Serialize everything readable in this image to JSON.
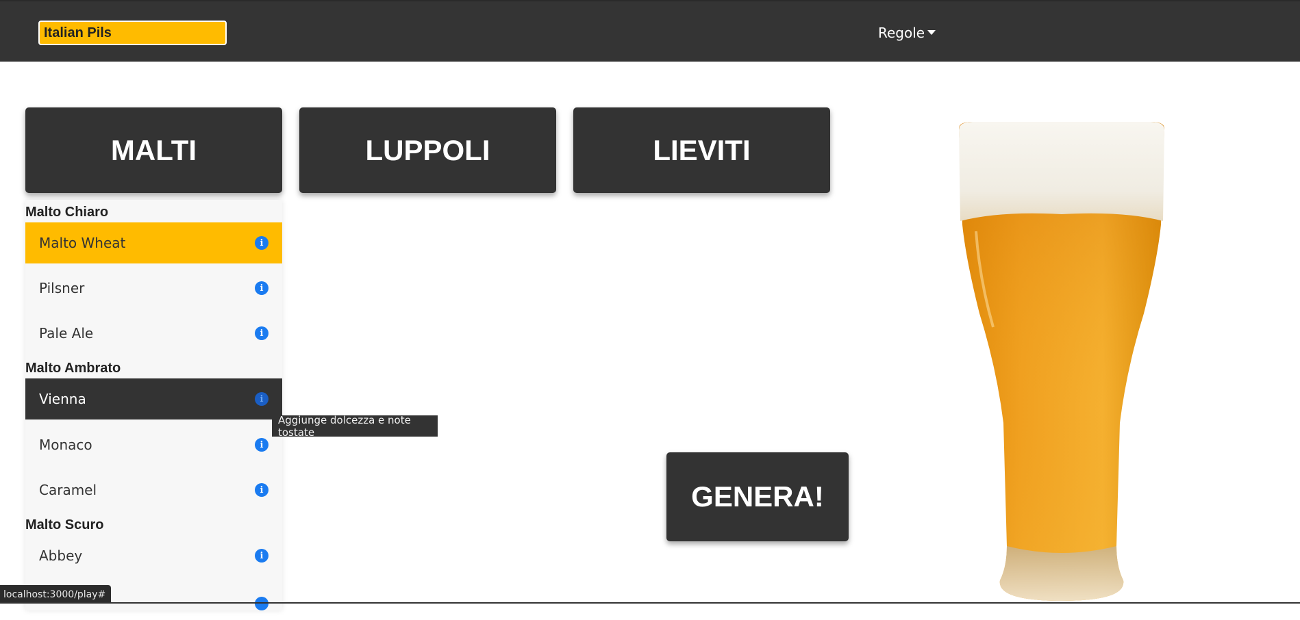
{
  "header": {
    "beer_name_value": "Italian Pils",
    "rules_label": "Regole"
  },
  "categories": {
    "malti": "MALTI",
    "luppoli": "LUPPOLI",
    "lieviti": "LIEVITI"
  },
  "malts": {
    "group1": {
      "title": "Malto Chiaro",
      "items": [
        "Malto Wheat",
        "Pilsner",
        "Pale Ale"
      ]
    },
    "group2": {
      "title": "Malto Ambrato",
      "items": [
        "Vienna",
        "Monaco",
        "Caramel"
      ]
    },
    "group3": {
      "title": "Malto Scuro",
      "items": [
        "Abbey"
      ]
    }
  },
  "tooltip": "Aggiunge dolcezza e note tostate",
  "generate_label": "GENERA!",
  "status_url": "localhost:3000/play#",
  "info_glyph": "i",
  "colors": {
    "accent": "#ffbb00",
    "dark": "#333333",
    "info": "#1a7bf0"
  }
}
